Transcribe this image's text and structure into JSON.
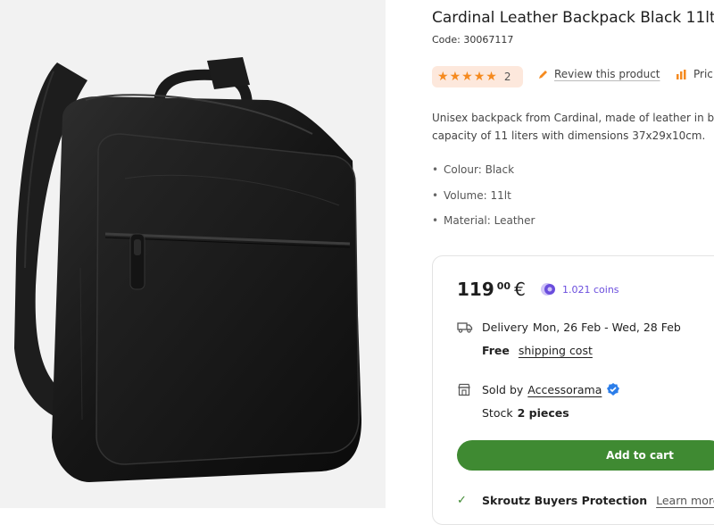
{
  "product": {
    "title": "Cardinal Leather Backpack Black 11lt",
    "code": "Code: 30067117",
    "rating_count": "2",
    "rating_stars": 5,
    "review_link": "Review this product",
    "price_link": "Pric",
    "description_line1": "Unisex backpack from Cardinal, made of leather in b",
    "description_line2": "capacity of 11 liters with dimensions 37x29x10cm.",
    "features": [
      "Colour: Black",
      "Volume: 11lt",
      "Material: Leather"
    ]
  },
  "buy_box": {
    "price_int": "119",
    "price_dec": "00",
    "currency": "€",
    "coins": "1.021 coins",
    "delivery_label": "Delivery",
    "delivery_dates": "Mon, 26 Feb - Wed, 28 Feb",
    "free_label": "Free",
    "shipping_link": "shipping cost",
    "sold_by_label": "Sold by",
    "seller": "Accessorama",
    "stock_label": "Stock",
    "stock_value": "2 pieces",
    "add_to_cart": "Add to cart",
    "protection_label": "Skroutz Buyers Protection",
    "learn_more": "Learn more"
  },
  "colors": {
    "accent_green": "#3f8a32",
    "star_orange": "#f58a1f",
    "rating_bg": "#fde8dc",
    "coins_purple": "#6a4ddd",
    "verified_blue": "#2b7de9"
  },
  "icons": [
    "pencil-icon",
    "price-chart-icon",
    "truck-icon",
    "shop-icon",
    "verified-icon",
    "coin-icon",
    "check-icon"
  ]
}
